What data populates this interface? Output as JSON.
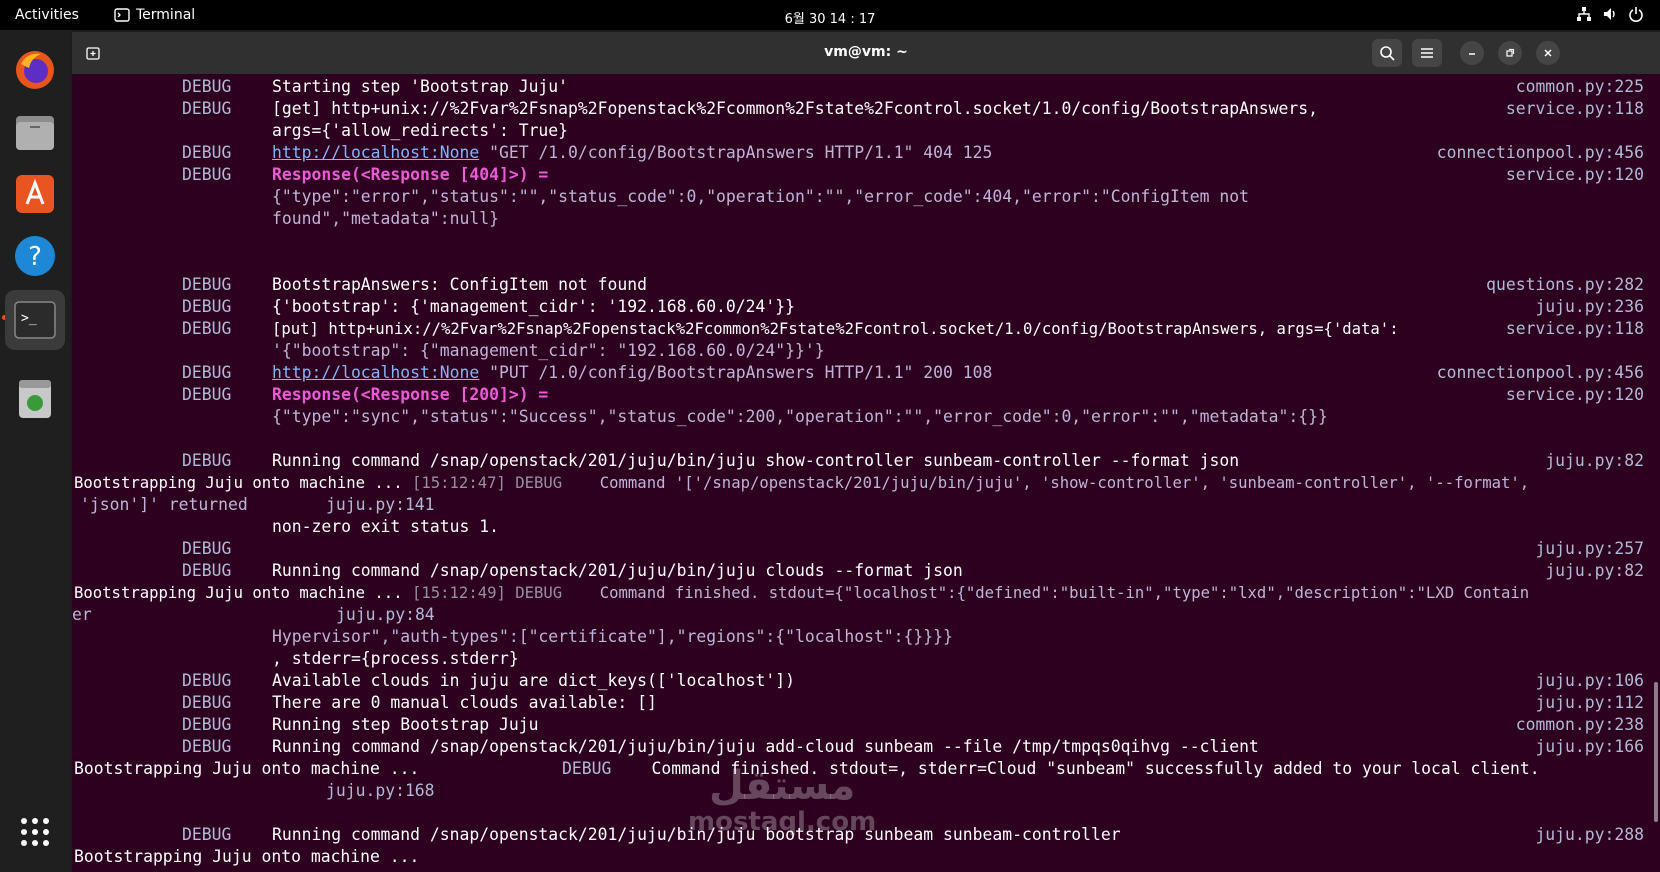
{
  "topbar": {
    "activities": "Activities",
    "app_name": "Terminal",
    "clock": "6월 30 14 : 17"
  },
  "window": {
    "title": "vm@vm: ~"
  },
  "dock": {
    "items": [
      "firefox-icon",
      "files-icon",
      "app-center-icon",
      "help-icon",
      "terminal-icon",
      "trash-icon",
      "show-apps-icon"
    ]
  },
  "watermark": {
    "arabic": "مستقل",
    "latin": "mostaql.com"
  },
  "terminal": {
    "l1": "Starting step 'Bootstrap Juju'",
    "l2": "[get] http+unix://%2Fvar%2Fsnap%2Fopenstack%2Fcommon%2Fstate%2Fcontrol.socket/1.0/config/BootstrapAnswers,",
    "l3": "args={'allow_redirects': True}",
    "l4_link": "http://localhost:None",
    "l4_rest": " \"GET /1.0/config/BootstrapAnswers HTTP/1.1\" 404 125",
    "l5": "Response(<Response [404]>) =",
    "l6": "{\"type\":\"error\",\"status\":\"\",\"status_code\":0,\"operation\":\"\",\"error_code\":404,\"error\":\"ConfigItem not",
    "l7": "found\",\"metadata\":null}",
    "l8": "BootstrapAnswers: ConfigItem not found",
    "l9": "{'bootstrap': {'management_cidr': '192.168.60.0/24'}}",
    "l10": "[put] http+unix://%2Fvar%2Fsnap%2Fopenstack%2Fcommon%2Fstate%2Fcontrol.socket/1.0/config/BootstrapAnswers, args={'data':",
    "l11": "'{\"bootstrap\": {\"management_cidr\": \"192.168.60.0/24\"}}'}",
    "l12_link": "http://localhost:None",
    "l12_rest": " \"PUT /1.0/config/BootstrapAnswers HTTP/1.1\" 200 108",
    "l13": "Response(<Response [200]>) =",
    "l14": "{\"type\":\"sync\",\"status\":\"Success\",\"status_code\":200,\"operation\":\"\",\"error_code\":0,\"error\":\"\",\"metadata\":{}}",
    "l15": "Running command /snap/openstack/201/juju/bin/juju show-controller sunbeam-controller --format json",
    "l16a": "Bootstrapping Juju onto machine ... ",
    "l16b": "[15:12:47] DEBUG",
    "l16c": "    Command '['/snap/openstack/201/juju/bin/juju', 'show-controller', 'sunbeam-controller', '--format',",
    "l17a": "'json']' returned",
    "l17b": "juju.py:141",
    "l18": "non-zero exit status 1.",
    "l20": "Running command /snap/openstack/201/juju/bin/juju clouds --format json",
    "l21a": "Bootstrapping Juju onto machine ... ",
    "l21b": "[15:12:49] DEBUG",
    "l21c": "    Command finished. stdout={\"localhost\":{\"defined\":\"built-in\",\"type\":\"lxd\",\"description\":\"LXD Contain",
    "l22a": "er",
    "l22b": "juju.py:84",
    "l23": "Hypervisor\",\"auth-types\":[\"certificate\"],\"regions\":{\"localhost\":{}}}}",
    "l24": ", stderr={process.stderr}",
    "l25": "Available clouds in juju are dict_keys(['localhost'])",
    "l26": "There are 0 manual clouds available: []",
    "l27": "Running step Bootstrap Juju",
    "l28": "Running command /tmp/tmpqs0qihvg --client",
    "l28_full": "Running command /snap/openstack/201/juju/bin/juju add-cloud sunbeam --file /tmp/tmpqs0qihvg --client",
    "l29a": "Bootstrapping Juju onto machine ... ",
    "l29b": "DEBUG",
    "l29c": "    Command finished. stdout=, stderr=Cloud \"sunbeam\" successfully added to your local client.",
    "l30": "juju.py:168",
    "l31": "Running command /snap/openstack/201/juju/bin/juju bootstrap sunbeam sunbeam-controller",
    "l32": "Bootstrapping Juju onto machine ...",
    "debug": "DEBUG",
    "src": {
      "s1": "common.py:225",
      "s2": "service.py:118",
      "s4": "connectionpool.py:456",
      "s5": "service.py:120",
      "s8": "questions.py:282",
      "s9": "juju.py:236",
      "s10": "service.py:118",
      "s12": "connectionpool.py:456",
      "s13": "service.py:120",
      "s15": "juju.py:82",
      "s19": "juju.py:257",
      "s20": "juju.py:82",
      "s25": "juju.py:106",
      "s26": "juju.py:112",
      "s27": "common.py:238",
      "s28": "juju.py:166",
      "s31": "juju.py:288"
    }
  }
}
